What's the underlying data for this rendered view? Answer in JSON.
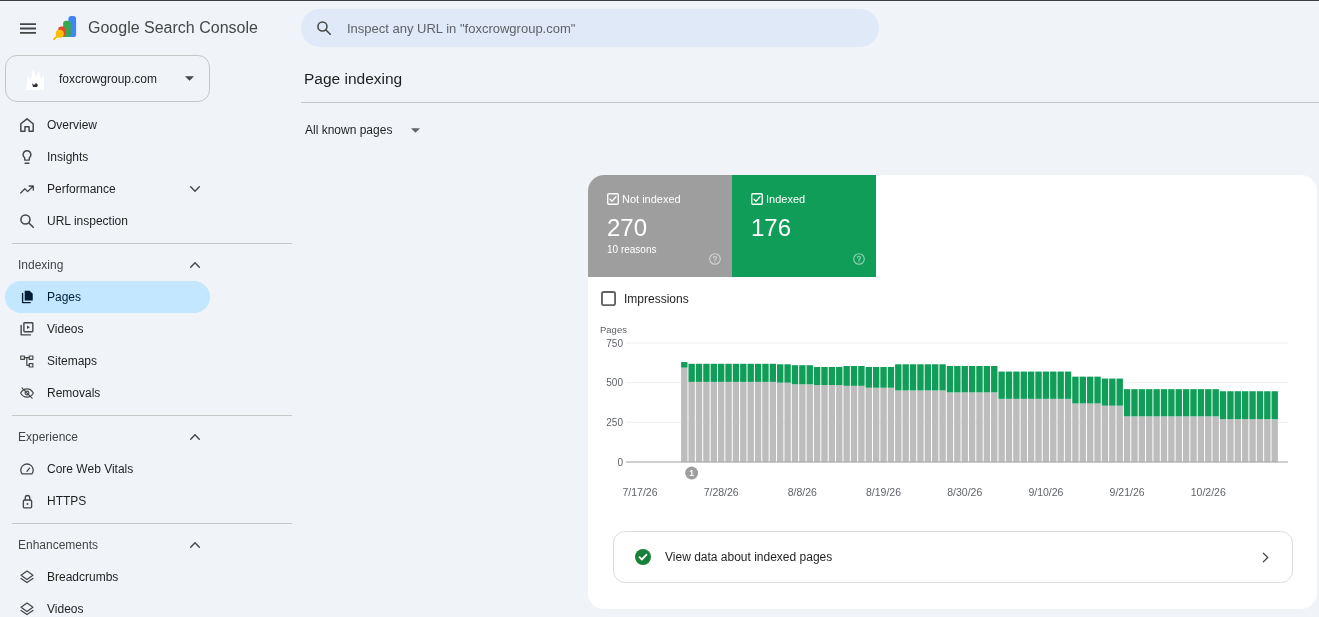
{
  "header": {
    "title": "Google Search Console",
    "search": {
      "placeholder": "Inspect any URL in \"foxcrowgroup.com\""
    }
  },
  "property": {
    "name": "foxcrowgroup.com"
  },
  "sidebar": {
    "sections": [
      {
        "items": [
          {
            "label": "Overview",
            "selected": false
          },
          {
            "label": "Insights",
            "selected": false
          },
          {
            "label": "Performance",
            "selected": false,
            "expanded": false
          },
          {
            "label": "URL inspection",
            "selected": false
          }
        ]
      },
      {
        "heading": "Indexing",
        "expanded": true,
        "items": [
          {
            "label": "Pages",
            "selected": true
          },
          {
            "label": "Videos",
            "selected": false
          },
          {
            "label": "Sitemaps",
            "selected": false
          },
          {
            "label": "Removals",
            "selected": false
          }
        ]
      },
      {
        "heading": "Experience",
        "expanded": true,
        "items": [
          {
            "label": "Core Web Vitals",
            "selected": false
          },
          {
            "label": "HTTPS",
            "selected": false
          }
        ]
      },
      {
        "heading": "Enhancements",
        "expanded": true,
        "items": [
          {
            "label": "Breadcrumbs",
            "selected": false
          },
          {
            "label": "Videos",
            "selected": false
          }
        ]
      }
    ]
  },
  "page": {
    "title": "Page indexing",
    "filter": {
      "value": "All known pages"
    }
  },
  "report": {
    "metrics": [
      {
        "label": "Not indexed",
        "value": "270",
        "sublabel": "10 reasons",
        "checked": true,
        "color": "#9e9e9e"
      },
      {
        "label": "Indexed",
        "value": "176",
        "checked": true,
        "color": "#0f9d58"
      }
    ],
    "impressions": {
      "label": "Impressions",
      "checked": false
    },
    "chart_data": {
      "type": "bar",
      "stacked": true,
      "ylabel": "Pages",
      "ylim": [
        0,
        750
      ],
      "yticks": [
        0,
        250,
        500,
        750
      ],
      "categories": [
        "7/17/26",
        null,
        null,
        null,
        null,
        null,
        null,
        null,
        null,
        null,
        null,
        "7/28/26",
        null,
        null,
        null,
        null,
        null,
        null,
        null,
        null,
        null,
        null,
        "8/8/26",
        null,
        null,
        null,
        null,
        null,
        null,
        null,
        null,
        null,
        null,
        "8/19/26",
        null,
        null,
        null,
        null,
        null,
        null,
        null,
        null,
        null,
        null,
        "8/30/26",
        null,
        null,
        null,
        null,
        null,
        null,
        null,
        null,
        null,
        null,
        "9/10/26",
        null,
        null,
        null,
        null,
        null,
        null,
        null,
        null,
        null,
        null,
        "9/21/26",
        null,
        null,
        null,
        null,
        null,
        null,
        null,
        null,
        null,
        null,
        "10/2/26",
        null,
        null,
        null,
        null,
        null,
        null,
        null,
        null,
        null
      ],
      "series": [
        {
          "color": "#bdbdbd",
          "values": [
            null,
            null,
            null,
            null,
            null,
            null,
            595,
            505,
            505,
            505,
            505,
            505,
            505,
            505,
            505,
            505,
            505,
            505,
            505,
            500,
            500,
            490,
            490,
            490,
            485,
            485,
            485,
            485,
            480,
            480,
            480,
            468,
            468,
            468,
            468,
            451,
            451,
            451,
            451,
            451,
            451,
            451,
            439,
            439,
            439,
            439,
            439,
            439,
            439,
            398,
            398,
            398,
            398,
            398,
            398,
            398,
            398,
            398,
            398,
            369,
            369,
            369,
            369,
            355,
            355,
            355,
            288,
            288,
            288,
            288,
            288,
            288,
            288,
            288,
            288,
            288,
            288,
            288,
            288,
            270,
            270,
            270,
            270,
            270,
            270,
            270,
            270
          ]
        },
        {
          "color": "#0f9d58",
          "values": [
            null,
            null,
            null,
            null,
            null,
            null,
            35,
            114,
            114,
            114,
            114,
            114,
            114,
            114,
            114,
            114,
            114,
            114,
            114,
            116,
            116,
            120,
            120,
            120,
            114,
            114,
            114,
            114,
            125,
            125,
            125,
            131,
            131,
            131,
            131,
            165,
            165,
            165,
            165,
            165,
            165,
            165,
            166,
            166,
            166,
            166,
            166,
            166,
            166,
            172,
            172,
            172,
            172,
            172,
            172,
            172,
            172,
            172,
            172,
            169,
            169,
            169,
            169,
            171,
            171,
            171,
            171,
            171,
            171,
            171,
            171,
            171,
            171,
            171,
            171,
            171,
            171,
            171,
            171,
            176,
            176,
            176,
            176,
            176,
            176,
            176,
            176
          ]
        }
      ],
      "annotations": [
        "1"
      ]
    },
    "link": {
      "label": "View data about indexed pages"
    }
  }
}
